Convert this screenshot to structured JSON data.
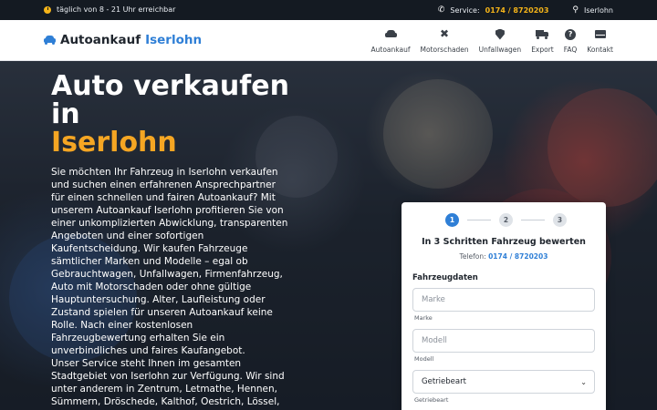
{
  "topbar": {
    "hours": "täglich von 8 - 21 Uhr erreichbar",
    "service_label": "Service:",
    "phone": "0174 / 8720203",
    "location": "Iserlohn"
  },
  "header": {
    "brand": "Autoankauf",
    "brand_city": "Iserlohn",
    "nav": [
      {
        "label": "Autoankauf",
        "icon": "car-icon"
      },
      {
        "label": "Motorschaden",
        "icon": "tools-icon"
      },
      {
        "label": "Unfallwagen",
        "icon": "shield-icon"
      },
      {
        "label": "Export",
        "icon": "truck-icon"
      },
      {
        "label": "FAQ",
        "icon": "question-icon"
      },
      {
        "label": "Kontakt",
        "icon": "mail-icon"
      }
    ]
  },
  "hero": {
    "title_line1": "Auto verkaufen",
    "title_line2": "in",
    "title_city": "Iserlohn",
    "paragraph1": "Sie möchten Ihr Fahrzeug in Iserlohn verkaufen und suchen einen erfahrenen Ansprechpartner für einen schnellen und fairen Autoankauf? Mit unserem Autoankauf Iserlohn profitieren Sie von einer unkomplizierten Abwicklung, transparenten Angeboten und einer sofortigen Kaufentscheidung. Wir kaufen Fahrzeuge sämtlicher Marken und Modelle – egal ob Gebrauchtwagen, Unfallwagen, Firmenfahrzeug, Auto mit Motorschaden oder ohne gültige Hauptuntersuchung. Alter, Laufleistung oder Zustand spielen für unseren Autoankauf keine Rolle. Nach einer kostenlosen Fahrzeugbewertung erhalten Sie ein unverbindliches und faires Kaufangebot.",
    "paragraph2": "Unser Service steht Ihnen im gesamten Stadtgebiet von Iserlohn zur Verfügung. Wir sind unter anderem in Zentrum, Letmathe, Hennen, Sümmern, Dröschede, Kalthof, Oestrich, Lössel, Kesbern, Griesenbrauck, Rheinen und Gerlingsen"
  },
  "form": {
    "steps": [
      "1",
      "2",
      "3"
    ],
    "active_step": 1,
    "title": "In 3 Schritten Fahrzeug bewerten",
    "phone_label": "Telefon:",
    "phone": "0174 / 8720203",
    "section": "Fahrzeugdaten",
    "fields": {
      "marke_placeholder": "Marke",
      "marke_help": "Marke",
      "modell_placeholder": "Modell",
      "modell_help": "Modell",
      "getriebe_value": "Getriebeart",
      "getriebe_help": "Getriebeart"
    }
  },
  "colors": {
    "accent_blue": "#2f7fd6",
    "accent_orange": "#f5a623",
    "phone_yellow": "#f5b419"
  }
}
